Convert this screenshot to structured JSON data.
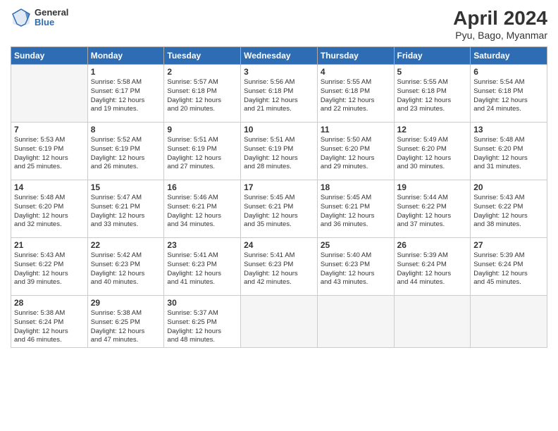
{
  "logo": {
    "general": "General",
    "blue": "Blue"
  },
  "title": "April 2024",
  "subtitle": "Pyu, Bago, Myanmar",
  "weekdays": [
    "Sunday",
    "Monday",
    "Tuesday",
    "Wednesday",
    "Thursday",
    "Friday",
    "Saturday"
  ],
  "weeks": [
    [
      {
        "num": "",
        "info": ""
      },
      {
        "num": "1",
        "info": "Sunrise: 5:58 AM\nSunset: 6:17 PM\nDaylight: 12 hours\nand 19 minutes."
      },
      {
        "num": "2",
        "info": "Sunrise: 5:57 AM\nSunset: 6:18 PM\nDaylight: 12 hours\nand 20 minutes."
      },
      {
        "num": "3",
        "info": "Sunrise: 5:56 AM\nSunset: 6:18 PM\nDaylight: 12 hours\nand 21 minutes."
      },
      {
        "num": "4",
        "info": "Sunrise: 5:55 AM\nSunset: 6:18 PM\nDaylight: 12 hours\nand 22 minutes."
      },
      {
        "num": "5",
        "info": "Sunrise: 5:55 AM\nSunset: 6:18 PM\nDaylight: 12 hours\nand 23 minutes."
      },
      {
        "num": "6",
        "info": "Sunrise: 5:54 AM\nSunset: 6:18 PM\nDaylight: 12 hours\nand 24 minutes."
      }
    ],
    [
      {
        "num": "7",
        "info": "Sunrise: 5:53 AM\nSunset: 6:19 PM\nDaylight: 12 hours\nand 25 minutes."
      },
      {
        "num": "8",
        "info": "Sunrise: 5:52 AM\nSunset: 6:19 PM\nDaylight: 12 hours\nand 26 minutes."
      },
      {
        "num": "9",
        "info": "Sunrise: 5:51 AM\nSunset: 6:19 PM\nDaylight: 12 hours\nand 27 minutes."
      },
      {
        "num": "10",
        "info": "Sunrise: 5:51 AM\nSunset: 6:19 PM\nDaylight: 12 hours\nand 28 minutes."
      },
      {
        "num": "11",
        "info": "Sunrise: 5:50 AM\nSunset: 6:20 PM\nDaylight: 12 hours\nand 29 minutes."
      },
      {
        "num": "12",
        "info": "Sunrise: 5:49 AM\nSunset: 6:20 PM\nDaylight: 12 hours\nand 30 minutes."
      },
      {
        "num": "13",
        "info": "Sunrise: 5:48 AM\nSunset: 6:20 PM\nDaylight: 12 hours\nand 31 minutes."
      }
    ],
    [
      {
        "num": "14",
        "info": "Sunrise: 5:48 AM\nSunset: 6:20 PM\nDaylight: 12 hours\nand 32 minutes."
      },
      {
        "num": "15",
        "info": "Sunrise: 5:47 AM\nSunset: 6:21 PM\nDaylight: 12 hours\nand 33 minutes."
      },
      {
        "num": "16",
        "info": "Sunrise: 5:46 AM\nSunset: 6:21 PM\nDaylight: 12 hours\nand 34 minutes."
      },
      {
        "num": "17",
        "info": "Sunrise: 5:45 AM\nSunset: 6:21 PM\nDaylight: 12 hours\nand 35 minutes."
      },
      {
        "num": "18",
        "info": "Sunrise: 5:45 AM\nSunset: 6:21 PM\nDaylight: 12 hours\nand 36 minutes."
      },
      {
        "num": "19",
        "info": "Sunrise: 5:44 AM\nSunset: 6:22 PM\nDaylight: 12 hours\nand 37 minutes."
      },
      {
        "num": "20",
        "info": "Sunrise: 5:43 AM\nSunset: 6:22 PM\nDaylight: 12 hours\nand 38 minutes."
      }
    ],
    [
      {
        "num": "21",
        "info": "Sunrise: 5:43 AM\nSunset: 6:22 PM\nDaylight: 12 hours\nand 39 minutes."
      },
      {
        "num": "22",
        "info": "Sunrise: 5:42 AM\nSunset: 6:23 PM\nDaylight: 12 hours\nand 40 minutes."
      },
      {
        "num": "23",
        "info": "Sunrise: 5:41 AM\nSunset: 6:23 PM\nDaylight: 12 hours\nand 41 minutes."
      },
      {
        "num": "24",
        "info": "Sunrise: 5:41 AM\nSunset: 6:23 PM\nDaylight: 12 hours\nand 42 minutes."
      },
      {
        "num": "25",
        "info": "Sunrise: 5:40 AM\nSunset: 6:23 PM\nDaylight: 12 hours\nand 43 minutes."
      },
      {
        "num": "26",
        "info": "Sunrise: 5:39 AM\nSunset: 6:24 PM\nDaylight: 12 hours\nand 44 minutes."
      },
      {
        "num": "27",
        "info": "Sunrise: 5:39 AM\nSunset: 6:24 PM\nDaylight: 12 hours\nand 45 minutes."
      }
    ],
    [
      {
        "num": "28",
        "info": "Sunrise: 5:38 AM\nSunset: 6:24 PM\nDaylight: 12 hours\nand 46 minutes."
      },
      {
        "num": "29",
        "info": "Sunrise: 5:38 AM\nSunset: 6:25 PM\nDaylight: 12 hours\nand 47 minutes."
      },
      {
        "num": "30",
        "info": "Sunrise: 5:37 AM\nSunset: 6:25 PM\nDaylight: 12 hours\nand 48 minutes."
      },
      {
        "num": "",
        "info": ""
      },
      {
        "num": "",
        "info": ""
      },
      {
        "num": "",
        "info": ""
      },
      {
        "num": "",
        "info": ""
      }
    ]
  ]
}
